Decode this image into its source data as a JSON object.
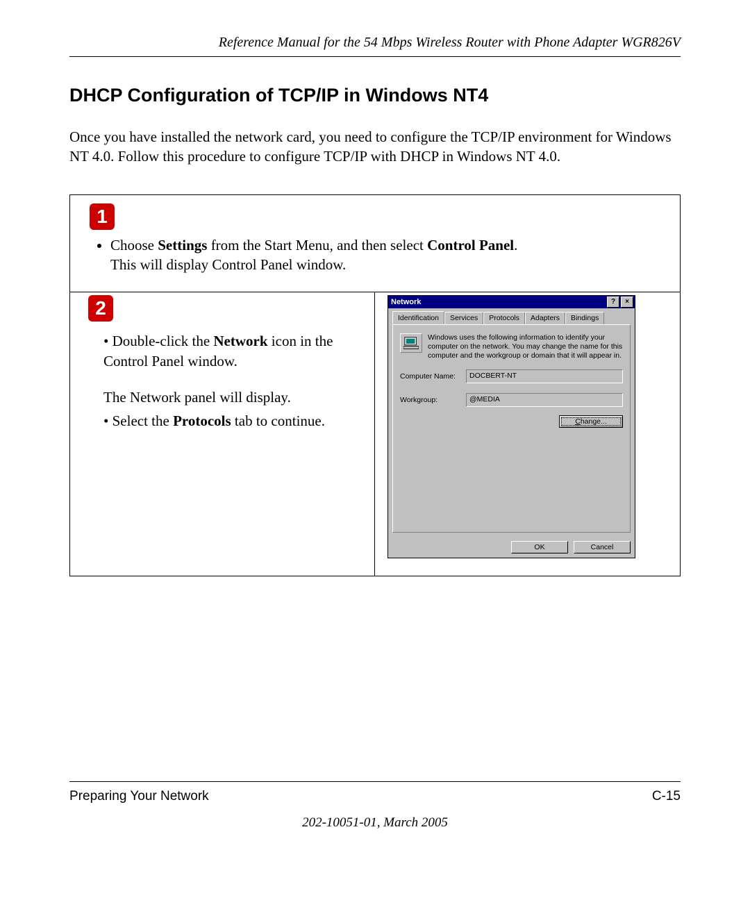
{
  "header": {
    "running_title": "Reference Manual for the 54 Mbps Wireless Router with Phone Adapter WGR826V"
  },
  "heading": "DHCP Configuration of TCP/IP in Windows NT4",
  "intro": "Once you have installed the network card, you need to configure the TCP/IP environment for Windows NT 4.0. Follow this procedure to configure TCP/IP with DHCP in Windows NT 4.0.",
  "step1": {
    "badge": "1",
    "bullet_prefix": "Choose ",
    "bullet_bold1": "Settings",
    "bullet_mid": " from the Start Menu, and then select ",
    "bullet_bold2": "Control Panel",
    "bullet_suffix": ".",
    "line2": "This will display Control Panel window."
  },
  "step2": {
    "badge": "2",
    "b1_prefix": "Double-click the ",
    "b1_bold": "Network",
    "b1_suffix": " icon in the Control Panel window.",
    "para": "The Network panel will display.",
    "b2_prefix": "Select the ",
    "b2_bold": "Protocols",
    "b2_suffix": " tab to continue."
  },
  "dialog": {
    "title": "Network",
    "help_btn": "?",
    "close_btn": "×",
    "tabs": [
      "Identification",
      "Services",
      "Protocols",
      "Adapters",
      "Bindings"
    ],
    "active_tab_index": 0,
    "description": "Windows uses the following information to identify your computer on the network.  You may change the name for this computer and the workgroup or domain that it will appear in.",
    "computer_name_label": "Computer Name:",
    "computer_name_value": "DOCBERT-NT",
    "workgroup_label": "Workgroup:",
    "workgroup_value": "@MEDIA",
    "change_btn": "Change...",
    "ok_btn": "OK",
    "cancel_btn": "Cancel"
  },
  "footer": {
    "left": "Preparing Your Network",
    "right": "C-15",
    "sub": "202-10051-01, March 2005"
  }
}
